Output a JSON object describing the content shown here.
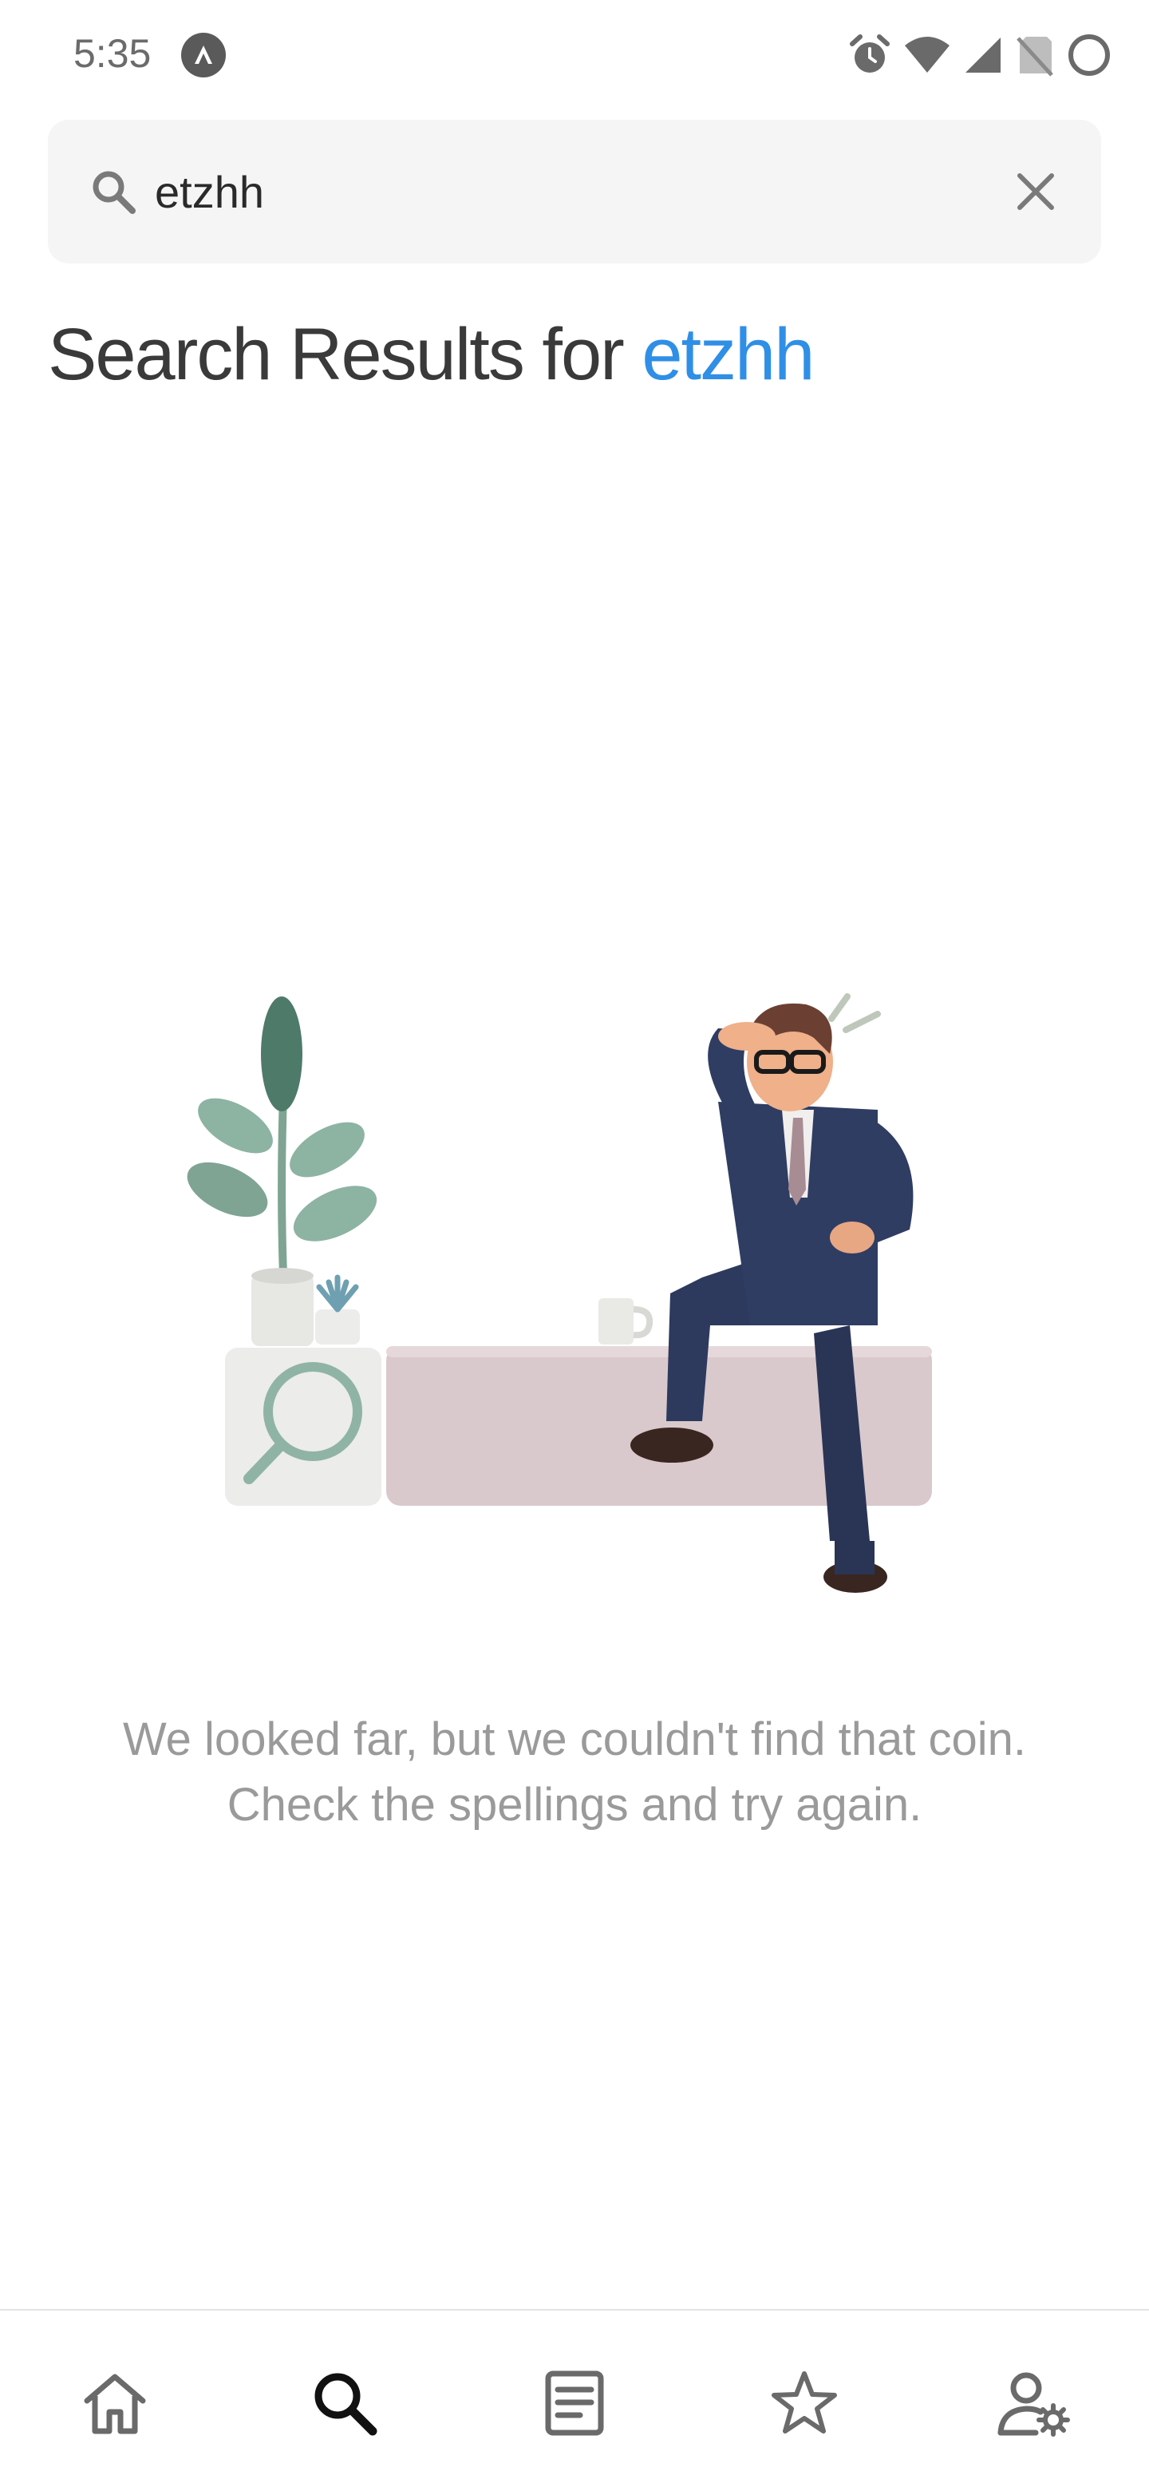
{
  "status_bar": {
    "time": "5:35",
    "icons": [
      "app-notification-icon",
      "alarm-icon",
      "wifi-icon",
      "signal-icon",
      "no-sim-icon",
      "battery-icon"
    ]
  },
  "search": {
    "value": "etzhh",
    "icons": [
      "search-icon",
      "clear-icon"
    ]
  },
  "results": {
    "title_prefix": "Search Results for ",
    "query": "etzhh",
    "query_color": "#2f8fe6"
  },
  "empty_state": {
    "line1": "We looked far, but we couldn't find that coin.",
    "line2": "Check the spellings and try again."
  },
  "bottom_nav": {
    "items": [
      {
        "name": "home",
        "icon": "home-icon",
        "active": false
      },
      {
        "name": "search",
        "icon": "search-icon",
        "active": true
      },
      {
        "name": "news",
        "icon": "document-icon",
        "active": false
      },
      {
        "name": "favorites",
        "icon": "star-icon",
        "active": false
      },
      {
        "name": "account-settings",
        "icon": "user-settings-icon",
        "active": false
      }
    ]
  }
}
